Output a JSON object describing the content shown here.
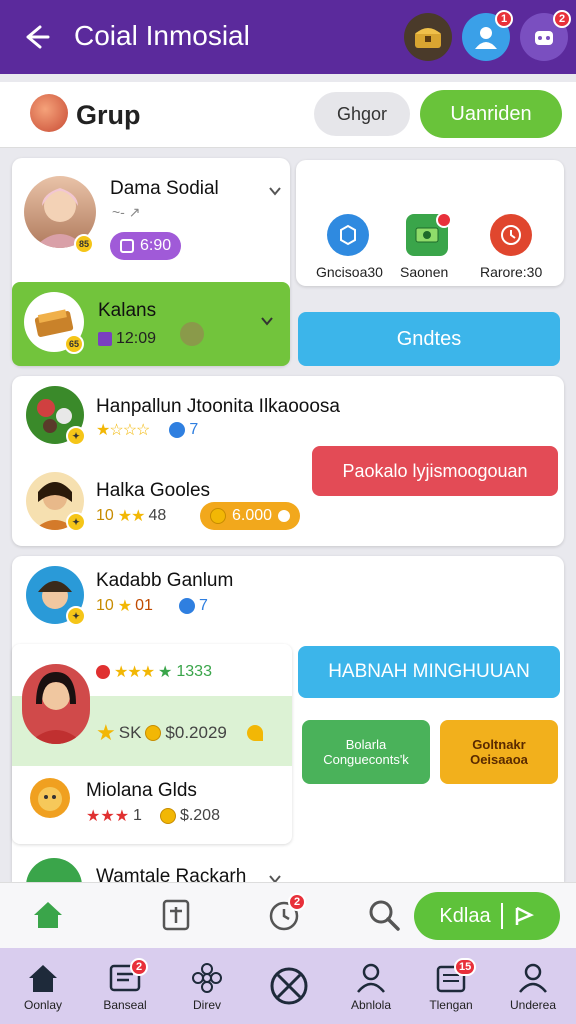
{
  "header": {
    "title": "Coial Inmosial",
    "badges": [
      "1",
      "2"
    ]
  },
  "group": {
    "title": "Grup",
    "secondary_btn": "Ghgor",
    "primary_btn": "Uanriden"
  },
  "profile_card": {
    "name": "Dama Sodial",
    "tag": "~- ↗",
    "badge_num": "85",
    "pill_value": "6:90"
  },
  "kalans_card": {
    "name": "Kalans",
    "value": "12:09",
    "badge_num": "65"
  },
  "quick_actions": [
    {
      "label": "Gncisoa30"
    },
    {
      "label": "Saonen"
    },
    {
      "label": "Rarore:30"
    }
  ],
  "gndtes_btn": "Gndtes",
  "list_card_1": {
    "row1": {
      "name": "Hanpallun Jtoonita Ilkaooosa",
      "stars": "★☆☆☆",
      "count": "7"
    },
    "row2": {
      "name": "Halka Gooles",
      "prefix": "10",
      "stars": "★★",
      "num": "48",
      "pill_value": "6.000"
    },
    "red_btn": "Paokalo lyjismoogouan"
  },
  "list_card_2": {
    "row1": {
      "name": "Kadabb Ganlum",
      "prefix": "10",
      "stars": "★",
      "num": "01",
      "count": "7"
    },
    "row2": {
      "stars": "★★★",
      "num": "1333"
    },
    "row3": {
      "left": "SK",
      "value": "$0.2029"
    },
    "row4": {
      "name": "Miolana Glds",
      "stars": "★★★",
      "num": "1",
      "value": "$.208"
    },
    "row5": {
      "name": "Wamtale Rackarh"
    }
  },
  "blue_btn_2": "HABNAH MINGHUUAN",
  "green_tile": "Bolarla Congueconts'k",
  "orange_tile": "Goltnakr Oeisaaoa",
  "action_bar": {
    "primary": "Kdlaa",
    "badge": "2"
  },
  "bottom_nav": [
    {
      "label": "Oonlay"
    },
    {
      "label": "Banseal",
      "badge": "2"
    },
    {
      "label": "Direv"
    },
    {
      "label": ""
    },
    {
      "label": "Abnlola"
    },
    {
      "label": "Tlengan",
      "badge": "15"
    },
    {
      "label": "Underea"
    }
  ],
  "colors": {
    "topbar": "#5b2a9c",
    "accent_green": "#69c33a",
    "accent_blue": "#3cb5ea",
    "accent_red": "#e34b56",
    "bottom_nav": "#d9cdee"
  }
}
